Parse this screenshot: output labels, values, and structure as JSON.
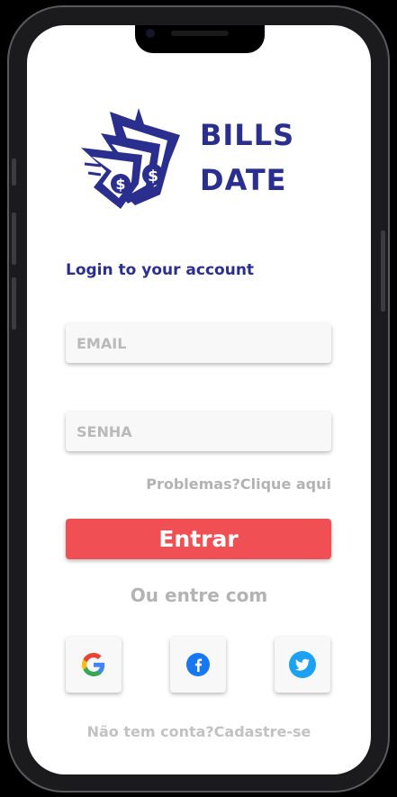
{
  "logo": {
    "line1": "BILLS",
    "line2": "DATE",
    "color": "#2a2f8f"
  },
  "login": {
    "heading": "Login to your account",
    "email_placeholder": "EMAIL",
    "password_placeholder": "SENHA",
    "forgot_label": "Problemas?Clique aqui",
    "submit_label": "Entrar",
    "submit_color": "#f05053"
  },
  "social": {
    "divider_label": "Ou entre com",
    "providers": [
      {
        "name": "google",
        "icon": "google-icon"
      },
      {
        "name": "facebook",
        "icon": "facebook-icon"
      },
      {
        "name": "twitter",
        "icon": "twitter-icon"
      }
    ]
  },
  "footer": {
    "signup_label": "Não tem conta?Cadastre-se"
  }
}
